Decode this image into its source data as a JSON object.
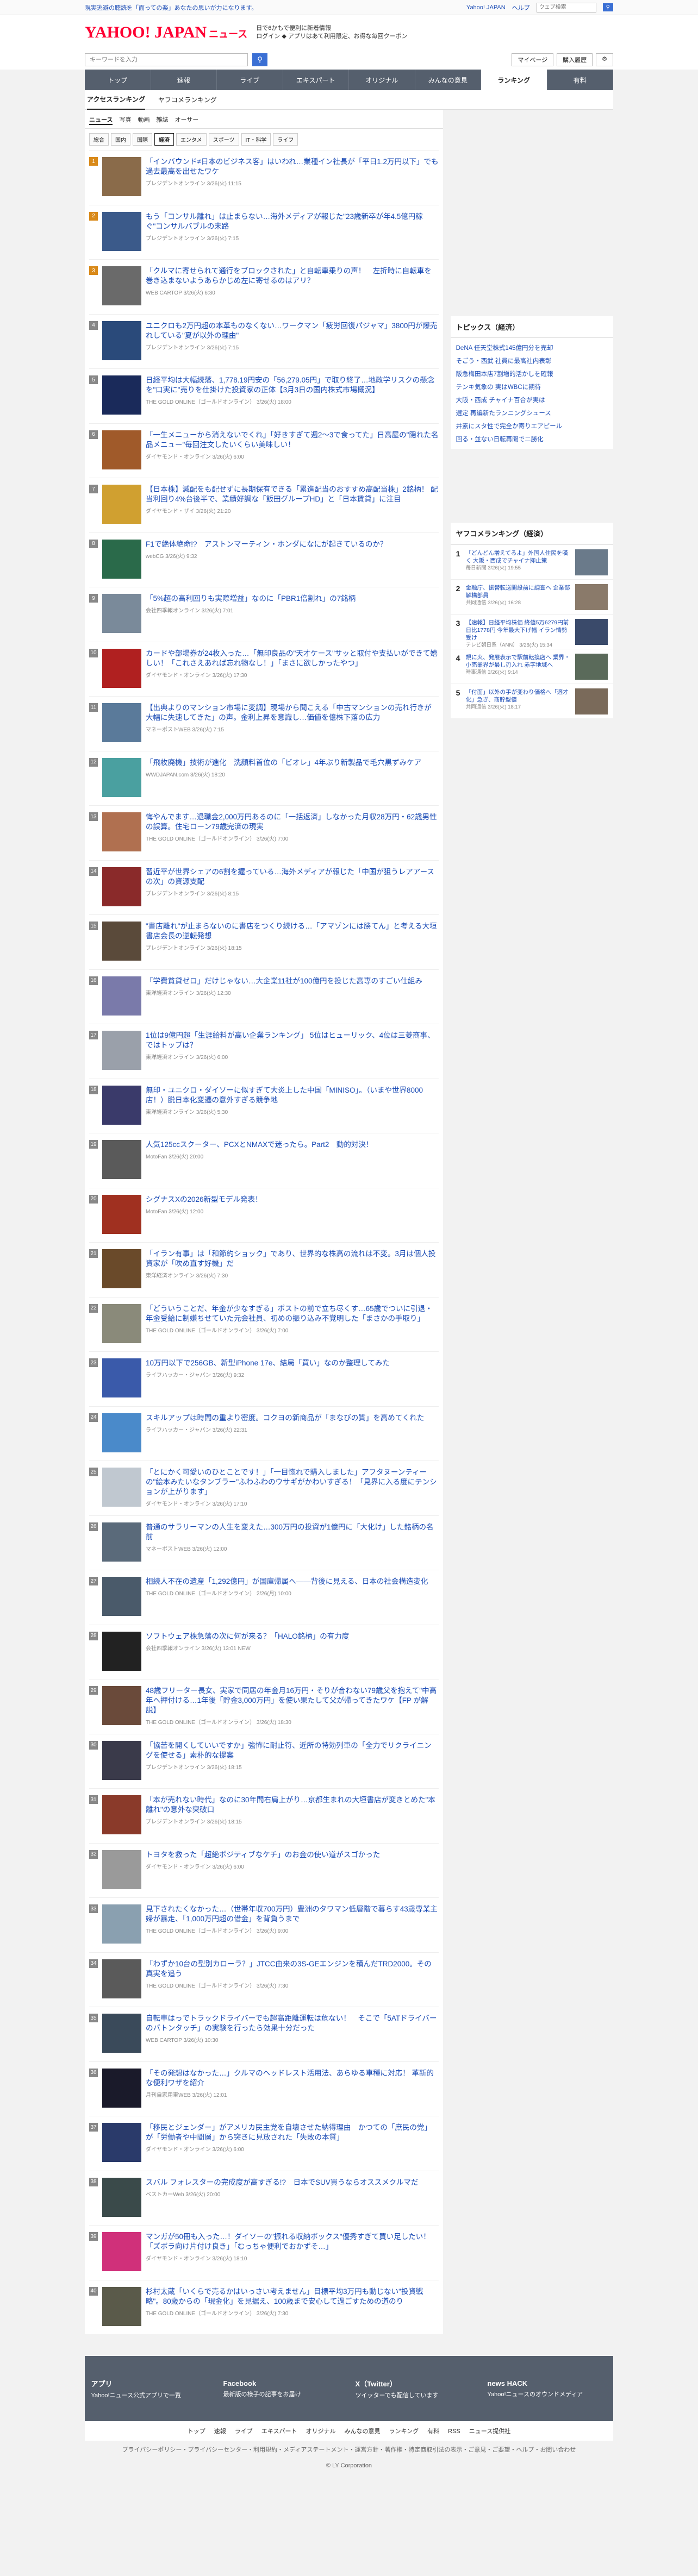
{
  "topbar": {
    "left": "現実逃避の聴読を「面っての楽」あなたの思いが力になります。",
    "links": [
      "Yahoo! JAPAN",
      "ヘルプ"
    ],
    "search_placeholder": "ウェブ検索"
  },
  "header": {
    "logo": "YAHOO! JAPAN",
    "logo_sub": "ニュース",
    "promo_line1": "日で6かもで便利に新着情報",
    "promo_line2": "ログイン ◆ アプリはあて利用限定、お得な毎回クーポン"
  },
  "searchbar": {
    "placeholder": "キーワードを入力",
    "mypage": "マイページ",
    "purchase": "購入履歴"
  },
  "nav": [
    "トップ",
    "速報",
    "ライブ",
    "エキスパート",
    "オリジナル",
    "みんなの意見",
    "ランキング",
    "有料"
  ],
  "subnav": [
    "アクセスランキング",
    "ヤフコメランキング"
  ],
  "cattabs": [
    "ニュース",
    "写真",
    "動画",
    "雑誌",
    "オーサー"
  ],
  "subtabs": [
    "総合",
    "国内",
    "国際",
    "経済",
    "エンタメ",
    "スポーツ",
    "IT・科学",
    "ライフ"
  ],
  "items": [
    {
      "rank": "1",
      "title": "「インバウンド≠日本のビジネス客」はいわれ…業種イン社長が「平日1.2万円以下」でも過去最高を出せたワケ",
      "meta": "プレジデントオンライン 3/26(火) 11:15",
      "color": "#8a6b4a"
    },
    {
      "rank": "2",
      "title": "もう「コンサル離れ」は止まらない…海外メディアが報じた\"23歳新卒が年4.5億円稼ぐ\"コンサルバブルの末路",
      "meta": "プレジデントオンライン 3/26(火) 7:15",
      "color": "#3b5a8a"
    },
    {
      "rank": "3",
      "title": "「クルマに寄せられて通行をブロックされた」と自転車乗りの声！　左折時に自転車を巻き込まないようあらかじめ左に寄せるのはアリ？",
      "meta": "WEB CARTOP 3/26(火) 6:30",
      "color": "#6a6a6a"
    },
    {
      "rank": "4",
      "title": "ユニクロも2万円超の本革ものなくない…ワークマン「疲労回復パジャマ」3800円が爆売れしている\"夏が以外の理由\"",
      "meta": "プレジデントオンライン 3/26(火) 7:15",
      "color": "#2a4a7a"
    },
    {
      "rank": "5",
      "title": "日経平均は大幅続落、1,778.19円安の「56,279.05円」で取り終了…地政学リスクの懸念を\"口実に\"売りを仕掛けた投資家の正体【3月3日の国内株式市場概況】",
      "meta": "THE GOLD ONLINE（ゴールドオンライン） 3/26(火) 18:00",
      "color": "#1a2a5a"
    },
    {
      "rank": "6",
      "title": "「一生メニューから消えないでくれ」「好きすぎて週2〜3で食ってた」日高屋の\"隠れた名品メニュー\"毎回注文したいくらい美味しい！",
      "meta": "ダイヤモンド・オンライン 3/26(火) 6:00",
      "color": "#a05a2a"
    },
    {
      "rank": "7",
      "title": "【日本株】減配をも配せずに長期保有できる「累進配当のおすすめ高配当株」2銘柄！ 配当利回り4%台後半で、業績好調な「飯田グループHD」と「日本賃貸」に注目",
      "meta": "ダイヤモンド・ザイ 3/26(火) 21:20",
      "color": "#d0a030"
    },
    {
      "rank": "8",
      "title": "F1で絶体絶命!?　アストンマーティン・ホンダになにが起きているのか？",
      "meta": "webCG 3/26(火) 9:32",
      "color": "#2a6a4a"
    },
    {
      "rank": "9",
      "title": "「5%超の高利回りも実際増益」なのに「PBR1倍割れ」の7銘柄",
      "meta": "会社四季報オンライン 3/26(火) 7:01",
      "color": "#7a8a9a"
    },
    {
      "rank": "10",
      "title": "カードや部場券が24枚入った…「無印良品の\"天才ケース\"サッと取付や支払いができて嬉しい！「これさえあれば忘れ物なし！」「まさに欲しかったやつ」",
      "meta": "ダイヤモンド・オンライン 3/26(火) 17:30",
      "color": "#b02020"
    },
    {
      "rank": "11",
      "title": "【出典よりのマンション市場に変調】現場から聞こえる「中古マンションの売れ行きが大幅に失速してきた」の声。金利上昇を意識し…価値を億株下落の広力",
      "meta": "マネーポストWEB 3/26(火) 7:15",
      "color": "#5a7a9a"
    },
    {
      "rank": "12",
      "title": "「飛枚廃機」技術が進化　洗顔料首位の「ビオレ」4年ぶり新製品で毛穴黒ずみケア",
      "meta": "WWDJAPAN.com 3/26(火) 18:20",
      "color": "#4aa0a0"
    },
    {
      "rank": "13",
      "title": "悔やんでます…退職金2,000万円あるのに「一括返済」しなかった月収28万円・62歳男性の誤算。住宅ローン79歳完済の現実",
      "meta": "THE GOLD ONLINE（ゴールドオンライン） 3/26(火) 7:00",
      "color": "#b07050"
    },
    {
      "rank": "14",
      "title": "習近平が世界シェアの6割を握っている…海外メディアが報じた「中国が狙うレアアースの次」の資源支配",
      "meta": "プレジデントオンライン 3/26(火) 8:15",
      "color": "#8a2a2a"
    },
    {
      "rank": "15",
      "title": "\"書店離れ\"が止まらないのに書店をつくり続ける…「アマゾンには勝てん」と考える大垣書店会長の逆転発想",
      "meta": "プレジデントオンライン 3/26(火) 18:15",
      "color": "#5a4a3a"
    },
    {
      "rank": "16",
      "title": "「学費貧貸ゼロ」だけじゃない…大企業11社が100億円を投じた高専のすごい仕組み",
      "meta": "東洋経済オンライン 3/26(火) 12:30",
      "color": "#7a7aaa"
    },
    {
      "rank": "17",
      "title": "1位は9億円超「生涯給料が高い企業ランキング」 5位はヒューリック、4位は三菱商事、ではトップは？",
      "meta": "東洋経済オンライン 3/26(火) 6:00",
      "color": "#9aa0aa"
    },
    {
      "rank": "18",
      "title": "無印・ユニクロ・ダイソーに似すぎて大炎上した中国「MINISO」。（いまや世界8000店！）脱日本化変遷の意外すぎる競争地",
      "meta": "東洋経済オンライン 3/26(火) 5:30",
      "color": "#3a3a6a"
    },
    {
      "rank": "19",
      "title": "人気125ccスクーター、PCXとNMAXで迷ったら。Part2　動的対決！",
      "meta": "MotoFan 3/26(火) 20:00",
      "color": "#5a5a5a"
    },
    {
      "rank": "20",
      "title": "シグナスXの2026新型モデル発表！",
      "meta": "MotoFan 3/26(火) 12:00",
      "color": "#a03020"
    },
    {
      "rank": "21",
      "title": "「イラン有事」は「和節約ショック」であり、世界的な株高の流れは不変。3月は個人投資家が「吹め直す好機」だ",
      "meta": "東洋経済オンライン 3/26(火) 7:30",
      "color": "#6a4a2a"
    },
    {
      "rank": "22",
      "title": "「どういうことだ、年金が少なすぎる」ポストの前で立ち尽くす…65歳でついに引退・年金受給に制嫌ちせていた元会社員、初めの振り込み不覚明した「まさかの手取り」",
      "meta": "THE GOLD ONLINE（ゴールドオンライン） 3/26(火) 7:00",
      "color": "#8a8a7a"
    },
    {
      "rank": "23",
      "title": "10万円以下で256GB、新型iPhone 17e、結局「買い」なのか整理してみた",
      "meta": "ライフハッカー・ジャパン 3/26(火) 9:32",
      "color": "#3a5aaa"
    },
    {
      "rank": "24",
      "title": "スキルアップは時間の重より密度。コクヨの新商品が「まなびの質」を高めてくれた",
      "meta": "ライフハッカー・ジャパン 3/26(火) 22:31",
      "color": "#4a8aca"
    },
    {
      "rank": "25",
      "title": "「とにかく可愛いのひとことです！」「一目惚れで購入しました」アフタヌーンティーの\"絵本みたいなタンブラー\"ふわふわのウサギがかわいすぎる！「見界に入る度にテンションが上がります」",
      "meta": "ダイヤモンド・オンライン 3/26(火) 17:10",
      "color": "#c0c8d0"
    },
    {
      "rank": "26",
      "title": "普通のサラリーマンの人生を変えた…300万円の投資が1億円に「大化け」した銘柄の名前",
      "meta": "マネーポストWEB 3/26(火) 12:00",
      "color": "#5a6a7a"
    },
    {
      "rank": "27",
      "title": "相続人不在の遺産「1,292億円」が国庫帰属へ――背後に見える、日本の社会構造変化",
      "meta": "THE GOLD ONLINE（ゴールドオンライン） 2/26(月) 10:00",
      "color": "#4a5a6a"
    },
    {
      "rank": "28",
      "title": "ソフトウェア株急落の次に何が来る？「HALO銘柄」の有力度",
      "meta": "会社四季報オンライン 3/26(火) 13:01 NEW",
      "color": "#222"
    },
    {
      "rank": "29",
      "title": "48歳フリーター長女、実家で同居の年金月16万円・そりが合わない79歳父を抱えて\"中高年へ押付ける…1年後「貯金3,000万円」を使い果たして父が帰ってきたワケ【FP が解説】",
      "meta": "THE GOLD ONLINE（ゴールドオンライン） 3/26(火) 18:30",
      "color": "#6a4a3a"
    },
    {
      "rank": "30",
      "title": "「協苦を開くしていいですか」強怖に耐止符、近所の特効列車の「全力でリクライニングを使せる」素朴的な提案",
      "meta": "プレジデントオンライン 3/26(火) 18:15",
      "color": "#3a3a4a"
    },
    {
      "rank": "31",
      "title": "「本が売れない時代」なのに30年間右肩上がり…京都生まれの大垣書店が変きとめた\"本離れ\"の意外な突破口",
      "meta": "プレジデントオンライン 3/26(火) 18:15",
      "color": "#8a3a2a"
    },
    {
      "rank": "32",
      "title": "トヨタを救った「超絶ポジティブなケチ」のお金の使い道がスゴかった",
      "meta": "ダイヤモンド・オンライン 3/26(火) 6:00",
      "color": "#9a9a9a"
    },
    {
      "rank": "33",
      "title": "見下されたくなかった…（世帯年収700万円）豊洲のタワマン低層階で暮らす43歳専業主婦が暴走、「1,000万円超の借金」を背負うまで",
      "meta": "THE GOLD ONLINE（ゴールドオンライン） 3/26(火) 9:00",
      "color": "#8aa0b0"
    },
    {
      "rank": "34",
      "title": "「わずか10台の型別カローラ？」JTCC由来の3S-GEエンジンを積んだTRD2000。その真実を追う",
      "meta": "THE GOLD ONLINE（ゴールドオンライン） 3/26(火) 7:30",
      "color": "#5a5a5a"
    },
    {
      "rank": "35",
      "title": "自転車はっでトラックドライバーでも超高距離運転は危ない！　そこで「5ATドライバーのバトンタッチ」の実験を行ったら効果十分だった",
      "meta": "WEB CARTOP 3/26(火) 10:30",
      "color": "#3a4a5a"
    },
    {
      "rank": "36",
      "title": "「その発想はなかった…」クルマのヘッドレスト活用法、あらゆる車種に対応！ 革新的な便利ワザを紹介",
      "meta": "月刊自家用車WEB 3/26(火) 12:01",
      "color": "#1a1a2a"
    },
    {
      "rank": "37",
      "title": "「移民とジェンダー」がアメリカ民主党を自壊させた納得理由　かつての「庶民の党」が「労働者や中間層」から突きに見放された「失敗の本質」",
      "meta": "ダイヤモンド・オンライン 3/26(火) 6:00",
      "color": "#2a3a6a"
    },
    {
      "rank": "38",
      "title": "スバル フォレスターの完成度が高すぎる!?　日本でSUV買うならオススメクルマだ",
      "meta": "ベストカーWeb 3/26(火) 20:00",
      "color": "#3a4a4a"
    },
    {
      "rank": "39",
      "title": "マンガが50冊も入った…！ダイソーの\"振れる収納ボックス\"優秀すぎて買い足したい！「ズボラ向け片付け良き」「むっちゃ便利でおかずそ…」",
      "meta": "ダイヤモンド・オンライン 3/26(火) 18:10",
      "color": "#d0307a"
    },
    {
      "rank": "40",
      "title": "杉村太蔵「いくらで売るかはいっさい考えません」目標平均3万円も動じない\"投資戦略\"。80歳からの「現金化」を見据え、100歳まで安心して過ごすための道のり",
      "meta": "THE GOLD ONLINE（ゴールドオンライン） 3/26(火) 7:30",
      "color": "#5a5a4a"
    }
  ],
  "side": {
    "topics_title": "トピックス（経済）",
    "topics": [
      "DeNA 任天堂株式145億円分を売却",
      "そごう・西武 社員に最高社内表彰",
      "阪急梅田本店7割増的活かしを確報",
      "テンキ気象の 実はWBCに期待",
      "大阪・西成 チャイナ百合が実は",
      "選定 再編新たランニングシュース",
      "井素にスタ性で完全か寄りエアピール",
      "回る・並ない日転再開で二勝化"
    ],
    "yr_title": "ヤフコメランキング（経済）",
    "yr": [
      {
        "n": "1",
        "t": "「どんどん増えてるよ」外国人住民を嘆く 大阪・西成でチャイナ抑止策",
        "m": "毎日新聞 3/26(火) 19:55"
      },
      {
        "n": "2",
        "t": "金融庁、振替転送開設前に調査へ 企業部解構部員",
        "m": "共同通信 3/26(火) 16:28"
      },
      {
        "n": "3",
        "t": "【速報】日経平均株価 終値5万6279円前日比1778円 今年最大下げ幅 イラン情勢受け",
        "m": "テレビ朝日系（ANN） 3/26(火) 15:34"
      },
      {
        "n": "4",
        "t": "規に火、発展表示で駅前転換店へ 業界・小売業界が最し刃入れ 赤字地域へ",
        "m": "時事通信 3/26(火) 9:14"
      },
      {
        "n": "5",
        "t": "「付面」以外の手が変わり価格へ「適才化」急ぎ、商貯型値",
        "m": "共同通信 3/26(火) 18:17"
      }
    ]
  },
  "footer": {
    "app": "アプリ",
    "app_desc": "Yahoo!ニュース公式アプリで一覧",
    "facebook": "Facebook",
    "facebook_desc": "最新版の様子の記事をお届け",
    "x": "X（Twitter）",
    "x_desc": "ツイッターでも配信しています",
    "hack": "news HACK",
    "hack_desc": "Yahoo!ニュースのオウンドメディア",
    "nav": [
      "トップ",
      "速報",
      "ライブ",
      "エキスパート",
      "オリジナル",
      "みんなの意見",
      "ランキング",
      "有料",
      "RSS",
      "ニュース提供社"
    ],
    "legal": "プライバシーポリシー・プライバシーセンター・利用規約・メディアステートメント・運営方針・著作権・特定商取引法の表示・ご意見・ご要望・ヘルプ・お問い合わせ",
    "copyright": "© LY Corporation"
  }
}
